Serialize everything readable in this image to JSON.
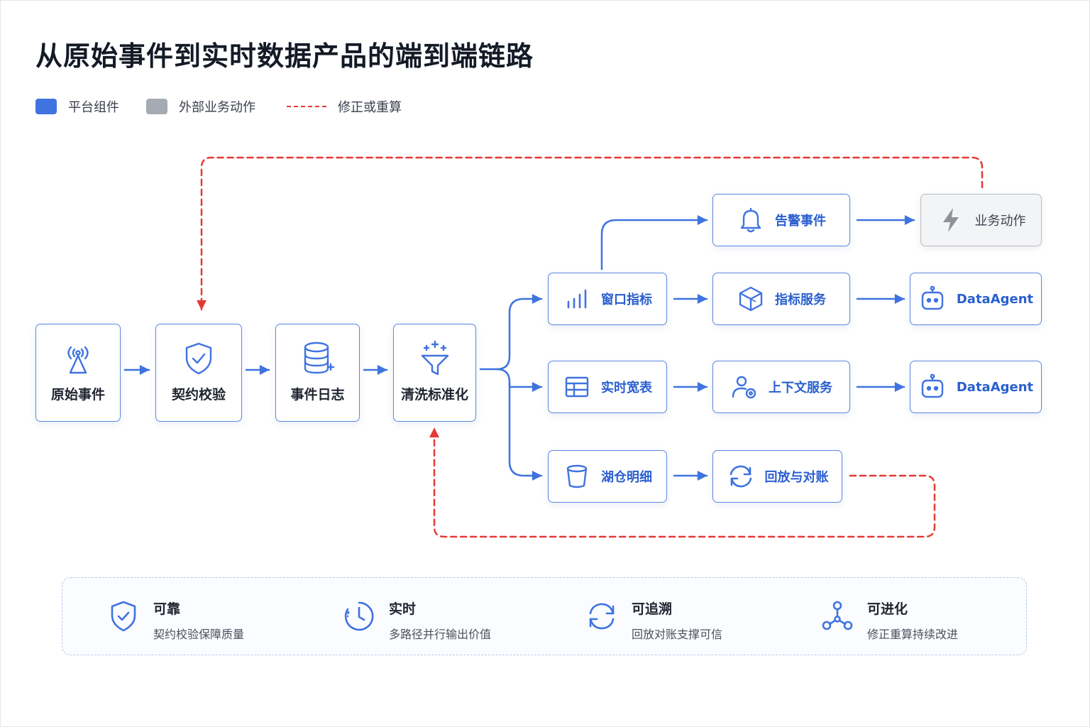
{
  "title": "从原始事件到实时数据产品的端到端链路",
  "legend": [
    {
      "label": "平台组件",
      "color": "#3f73e0",
      "kind": "swatch"
    },
    {
      "label": "外部业务动作",
      "color": "#a6aab2",
      "kind": "swatch"
    },
    {
      "label": "修正或重算",
      "color": "#e53935",
      "kind": "dashed-line"
    }
  ],
  "nodes": {
    "raw": {
      "label": "原始事件",
      "icon": "antenna-icon"
    },
    "contract": {
      "label": "契约校验",
      "icon": "shield-check-icon"
    },
    "log": {
      "label": "事件日志",
      "icon": "database-icon"
    },
    "clean": {
      "label": "清洗标准化",
      "icon": "funnel-sparkle-icon"
    },
    "window": {
      "label": "窗口指标",
      "icon": "bar-chart-icon"
    },
    "wide": {
      "label": "实时宽表",
      "icon": "table-icon"
    },
    "lake": {
      "label": "湖仓明细",
      "icon": "bucket-icon"
    },
    "alert": {
      "label": "告警事件",
      "icon": "bell-icon"
    },
    "metric": {
      "label": "指标服务",
      "icon": "cube-icon"
    },
    "context": {
      "label": "上下文服务",
      "icon": "user-settings-icon"
    },
    "replay": {
      "label": "回放与对账",
      "icon": "refresh-icon"
    },
    "action": {
      "label": "业务动作",
      "icon": "lightning-icon"
    },
    "agent1": {
      "label": "DataAgent",
      "icon": "robot-icon"
    },
    "agent2": {
      "label": "DataAgent",
      "icon": "robot-icon"
    }
  },
  "colors": {
    "primary": "#3f73e0",
    "correction": "#e53935",
    "external": "#a6aab2"
  },
  "features": [
    {
      "title": "可靠",
      "desc": "契约校验保障质量",
      "icon": "shield-check-icon"
    },
    {
      "title": "实时",
      "desc": "多路径并行输出价值",
      "icon": "clock-icon"
    },
    {
      "title": "可追溯",
      "desc": "回放对账支撑可信",
      "icon": "refresh-icon"
    },
    {
      "title": "可进化",
      "desc": "修正重算持续改进",
      "icon": "graph-nodes-icon"
    }
  ]
}
